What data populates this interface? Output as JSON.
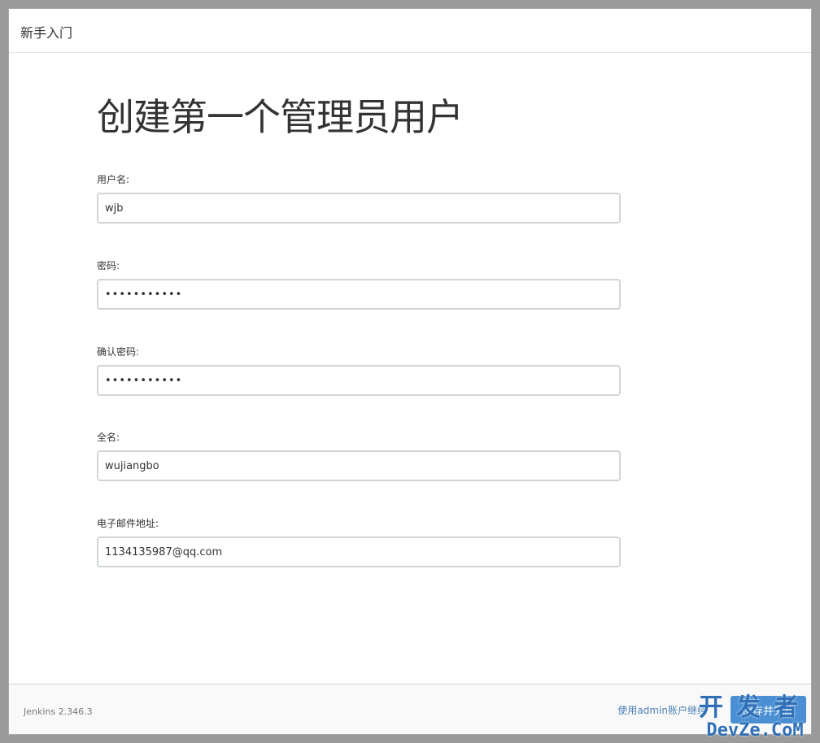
{
  "header": {
    "title": "新手入门"
  },
  "main": {
    "title": "创建第一个管理员用户",
    "fields": [
      {
        "label": "用户名:",
        "value": "wjb"
      },
      {
        "label": "密码:",
        "value": "•••••••••••"
      },
      {
        "label": "确认密码:",
        "value": "•••••••••••"
      },
      {
        "label": "全名:",
        "value": "wujiangbo"
      },
      {
        "label": "电子邮件地址:",
        "value": "1134135987@qq.com"
      }
    ]
  },
  "footer": {
    "version": "Jenkins 2.346.3",
    "skip_link": "使用admin账户继续",
    "save_label": "保存并完成"
  },
  "watermark": {
    "line1": "开发者",
    "line2": "DevZe.CoM"
  }
}
